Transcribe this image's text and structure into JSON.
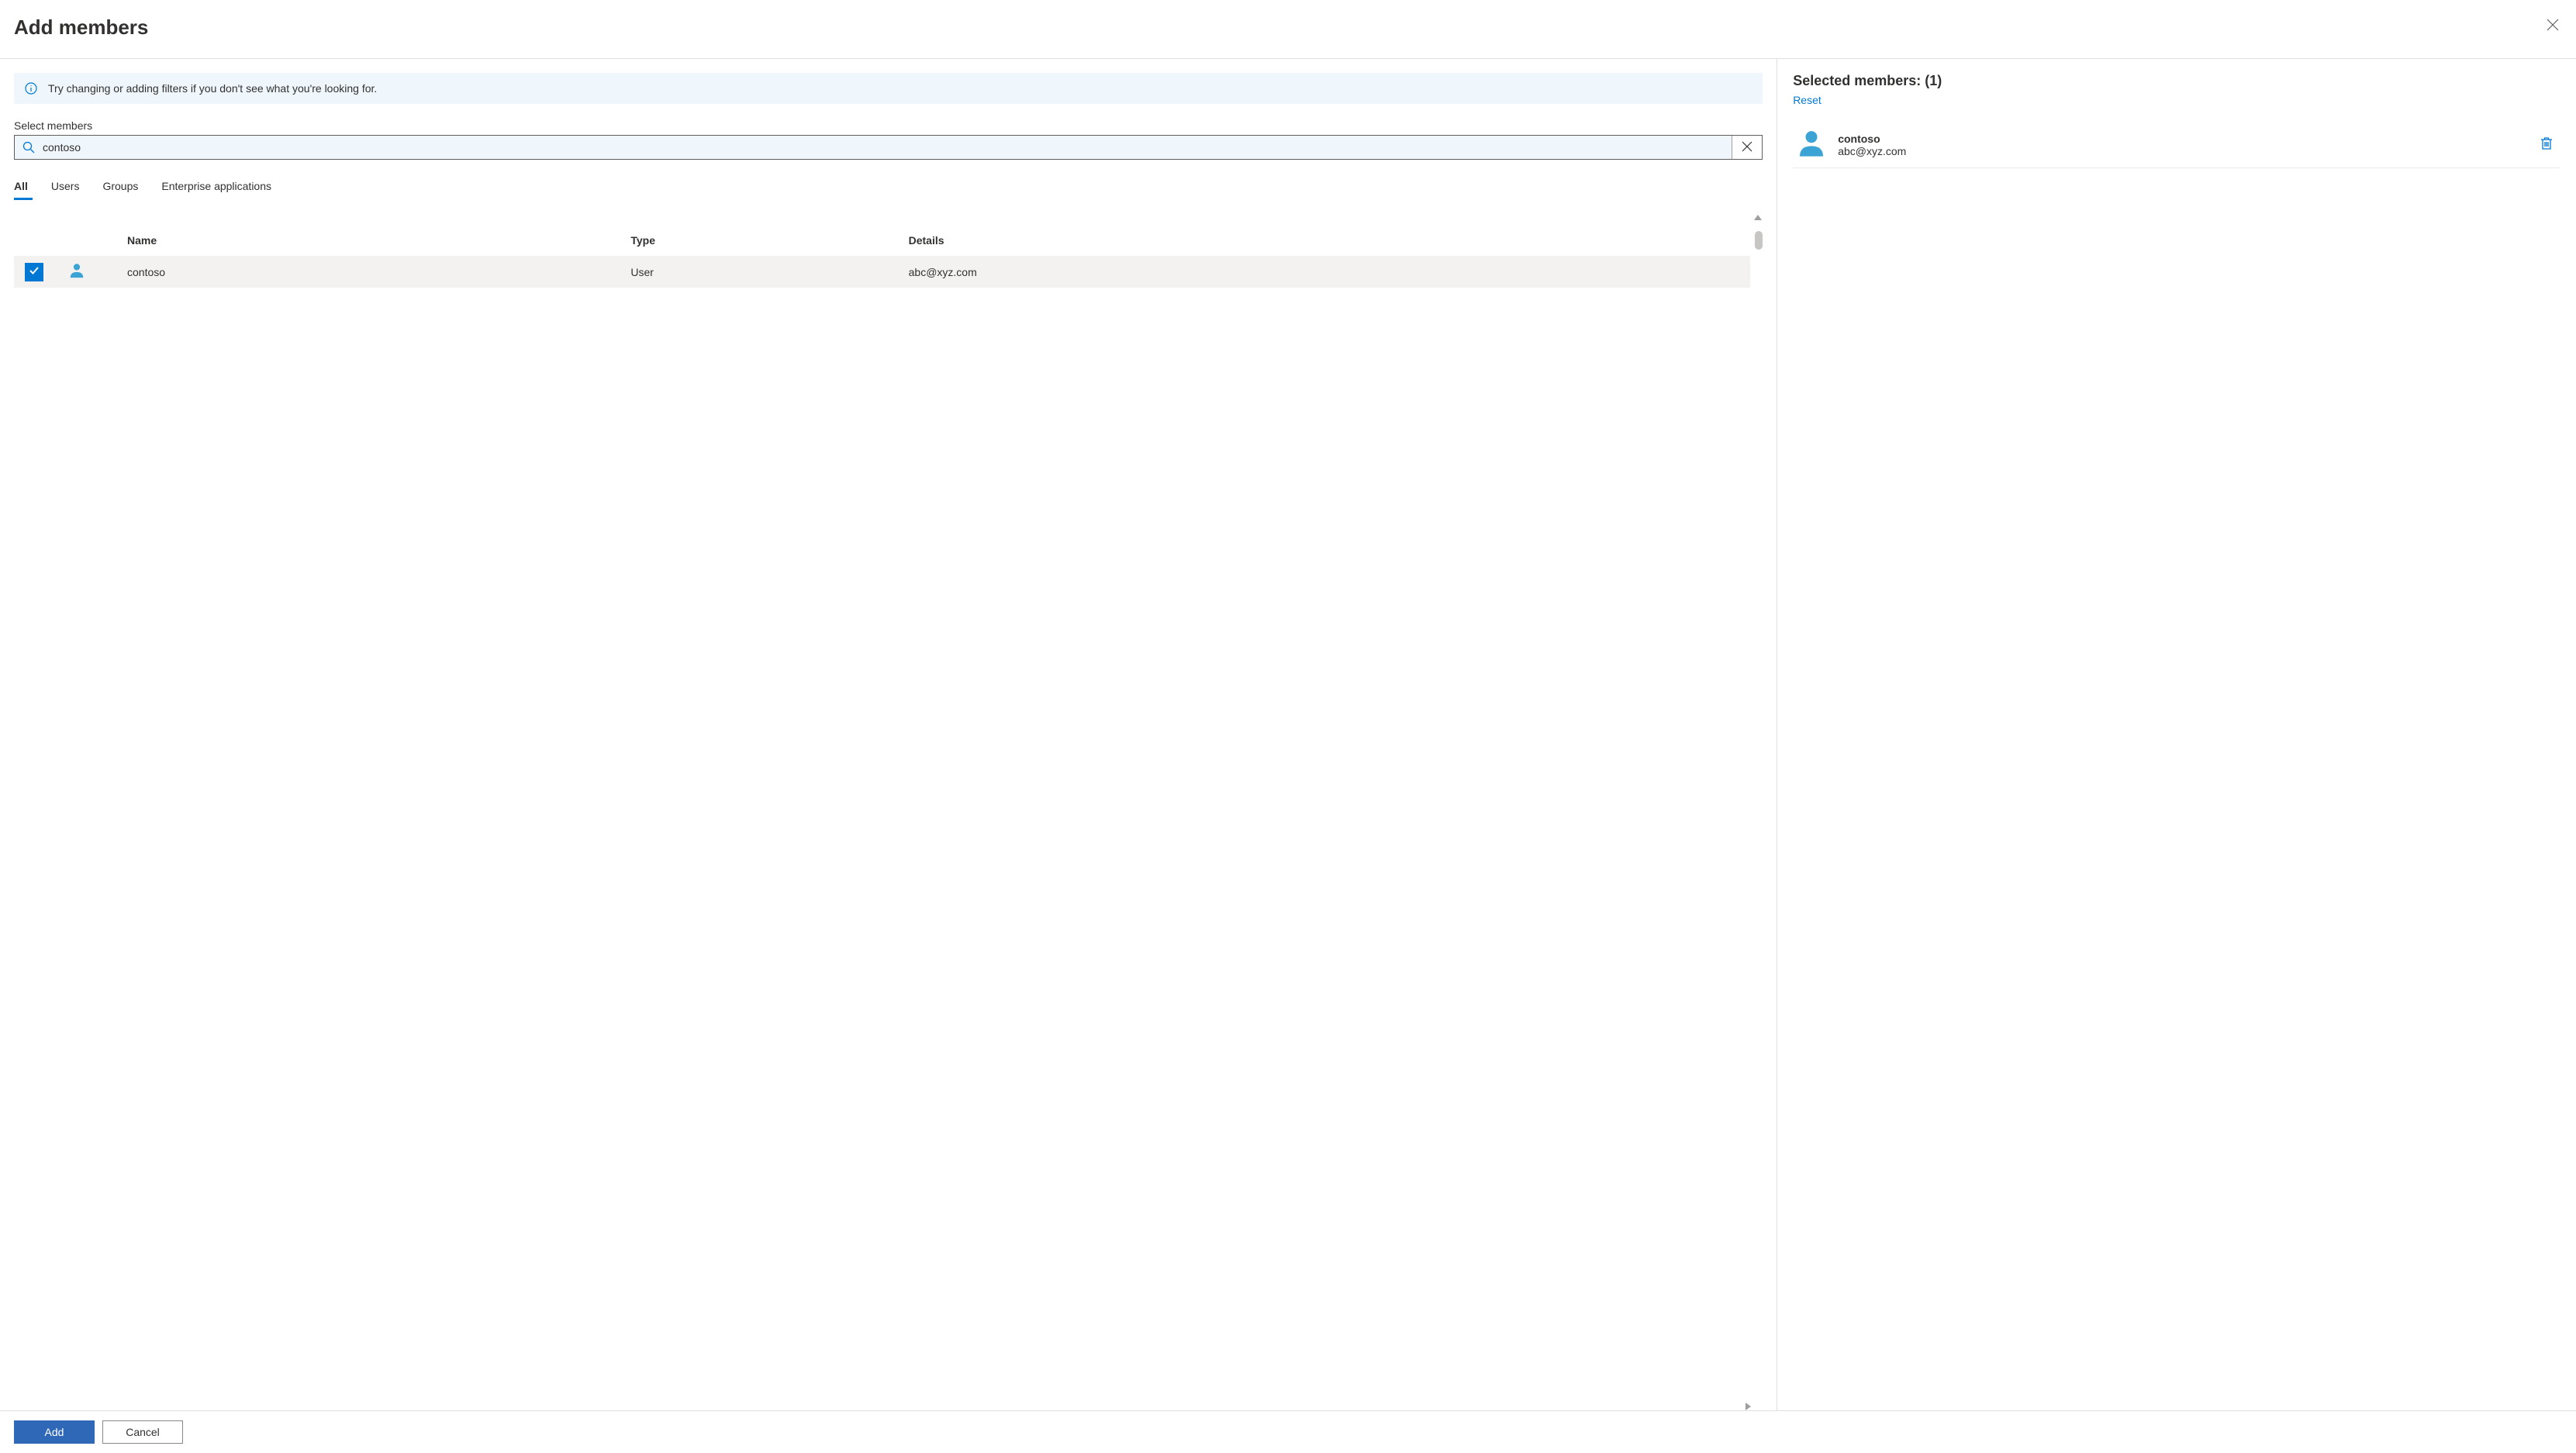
{
  "header": {
    "title": "Add members"
  },
  "info_banner": {
    "text": "Try changing or adding filters if you don't see what you're looking for."
  },
  "search": {
    "label": "Select members",
    "value": "contoso"
  },
  "tabs": {
    "items": [
      {
        "label": "All",
        "active": true
      },
      {
        "label": "Users",
        "active": false
      },
      {
        "label": "Groups",
        "active": false
      },
      {
        "label": "Enterprise applications",
        "active": false
      }
    ]
  },
  "table": {
    "headers": {
      "name": "Name",
      "type": "Type",
      "details": "Details"
    },
    "rows": [
      {
        "selected": true,
        "name": "contoso",
        "type": "User",
        "details": "abc@xyz.com"
      }
    ]
  },
  "selected_panel": {
    "title": "Selected members: (1)",
    "reset_label": "Reset",
    "items": [
      {
        "name": "contoso",
        "details": "abc@xyz.com"
      }
    ]
  },
  "footer": {
    "add_label": "Add",
    "cancel_label": "Cancel"
  }
}
